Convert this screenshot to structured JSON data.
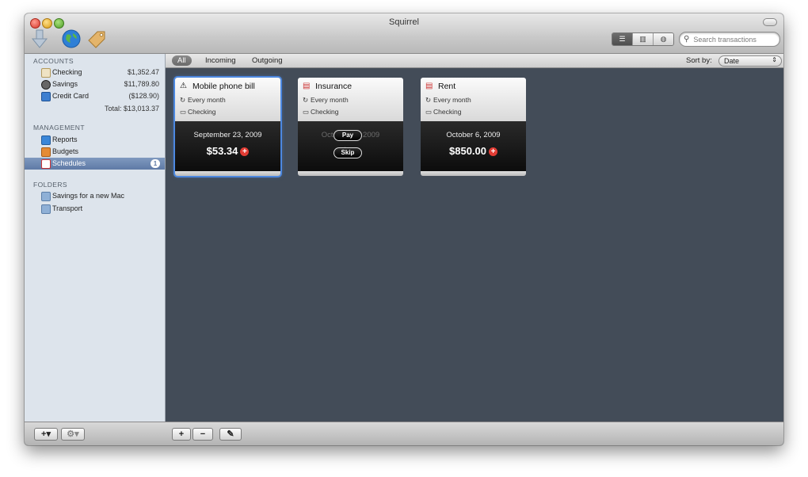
{
  "window": {
    "title": "Squirrel"
  },
  "toolbar": {
    "icons": [
      "import-arrow-icon",
      "globe-icon",
      "tag-icon"
    ],
    "view_modes": [
      "list-view",
      "column-view",
      "globe-view"
    ],
    "search_placeholder": "Search transactions"
  },
  "sidebar": {
    "accounts_header": "ACCOUNTS",
    "accounts": [
      {
        "label": "Checking",
        "amount": "$1,352.47",
        "icon": "checkbook-icon"
      },
      {
        "label": "Savings",
        "amount": "$11,789.80",
        "icon": "savings-icon"
      },
      {
        "label": "Credit Card",
        "amount": "($128.90)",
        "icon": "credit-card-icon"
      }
    ],
    "accounts_total": "Total: $13,013.37",
    "management_header": "MANAGEMENT",
    "management": [
      {
        "label": "Reports",
        "icon": "reports-icon"
      },
      {
        "label": "Budgets",
        "icon": "budgets-icon"
      },
      {
        "label": "Schedules",
        "icon": "calendar-icon",
        "badge": "1"
      }
    ],
    "folders_header": "FOLDERS",
    "folders": [
      {
        "label": "Savings for a new Mac",
        "icon": "folder-icon"
      },
      {
        "label": "Transport",
        "icon": "folder-icon"
      }
    ]
  },
  "filter": {
    "tabs": [
      "All",
      "Incoming",
      "Outgoing"
    ],
    "active_tab": "All",
    "sort_label": "Sort by:",
    "sort_value": "Date"
  },
  "schedules": [
    {
      "title": "Mobile phone bill",
      "recurrence": "Every month",
      "account": "Checking",
      "date": "September 23, 2009",
      "amount": "$53.34",
      "icon": "warning-icon"
    },
    {
      "title": "Insurance",
      "recurrence": "Every month",
      "account": "Checking",
      "date": "October 23, 2009",
      "amount": "$",
      "icon": "calendar-icon",
      "actions": [
        "Pay",
        "Skip"
      ]
    },
    {
      "title": "Rent",
      "recurrence": "Every month",
      "account": "Checking",
      "date": "October 6, 2009",
      "amount": "$850.00",
      "icon": "calendar-icon"
    }
  ],
  "bottom": {
    "sidebar_buttons": [
      "+▾",
      "⚙▾"
    ],
    "content_buttons": [
      "+",
      "−",
      "✎"
    ]
  },
  "colors": {
    "selection": "#5f7aa6",
    "content_bg": "#434c58",
    "sidebar_bg": "#dde4ec",
    "delete": "#e23c34"
  }
}
